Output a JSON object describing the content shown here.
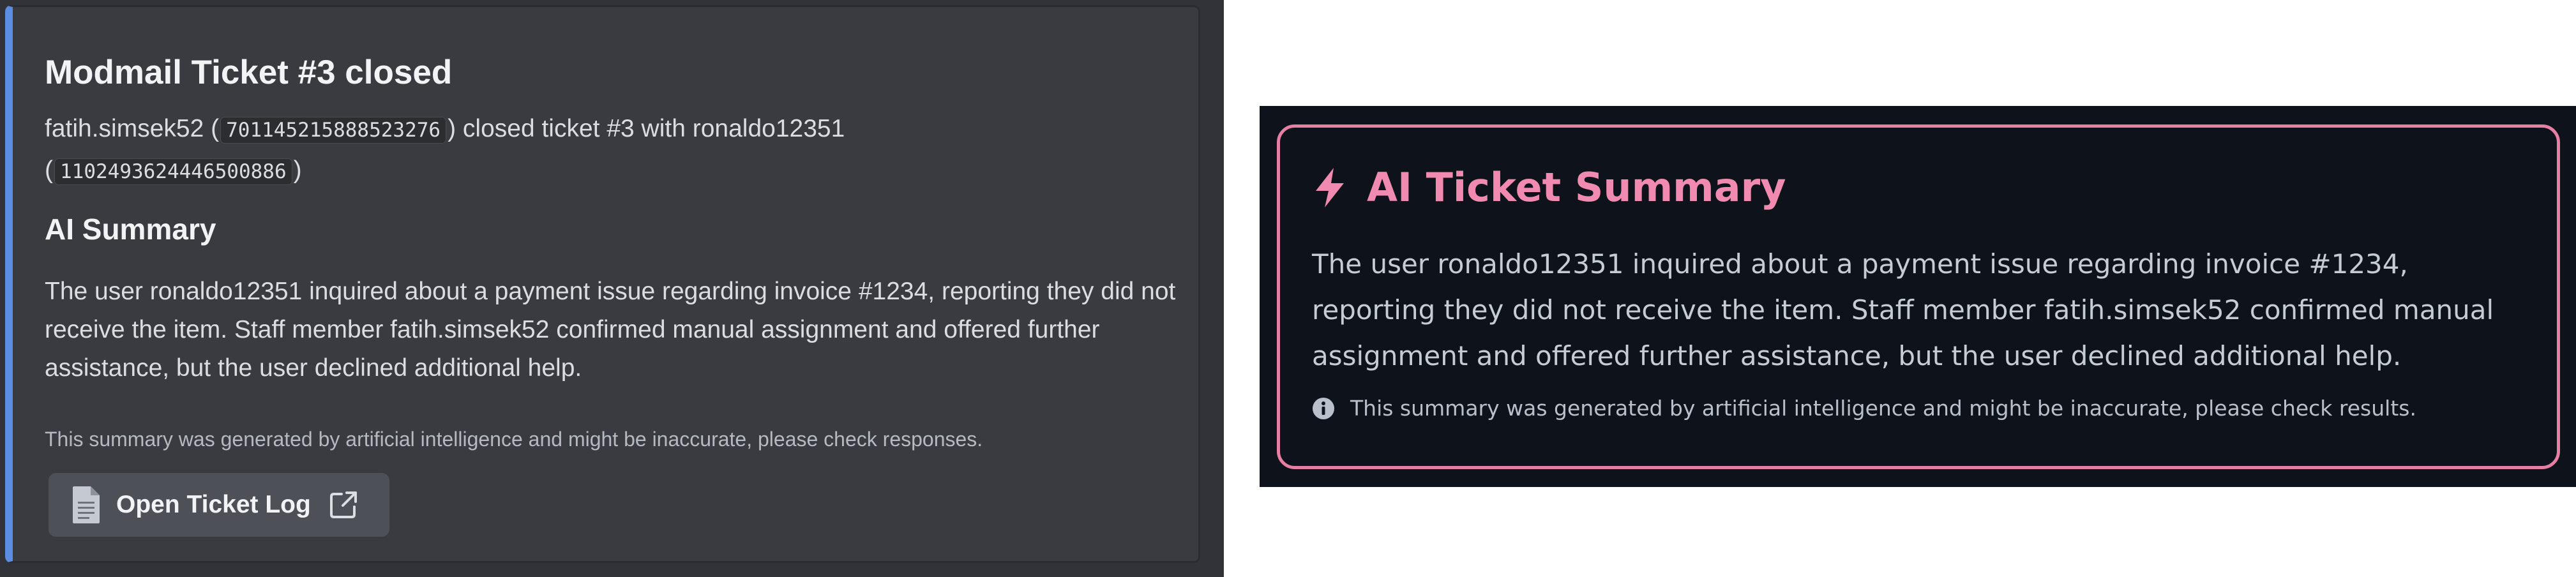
{
  "discord_embed": {
    "title": "Modmail Ticket #3 closed",
    "closer_name": "fatih.simsek52",
    "open_paren_1": "(",
    "closer_id": "701145215888523276",
    "close_text": ") closed ticket #3 with ronaldo12351",
    "open_paren_2": "(",
    "user_id": "1102493624446500886",
    "close_paren_2": ")",
    "section_title": "AI Summary",
    "summary": "The user ronaldo12351 inquired about a payment issue regarding invoice #1234, reporting they did not receive the item. Staff member fatih.simsek52 confirmed manual assignment and offered further assistance, but the user declined additional help.",
    "disclaimer": "This summary was generated by artificial intelligence and might be inaccurate, please check responses.",
    "button_label": "Open Ticket Log",
    "button_icons": [
      "document-icon",
      "external-link-icon"
    ]
  },
  "ai_summary_card": {
    "title": "AI Ticket Summary",
    "title_icon": "lightning-bolt-icon",
    "summary": "The user ronaldo12351 inquired about a payment issue regarding invoice #1234, reporting they did not receive the item. Staff member fatih.simsek52 confirmed manual assignment and offered further assistance, but the user declined additional help.",
    "note_icon": "info-icon",
    "note": "This summary was generated by artificial intelligence and might be inaccurate, please check results."
  },
  "colors": {
    "discord_bg": "#313338",
    "embed_bg": "#393b41",
    "embed_accent": "#5b8de2",
    "card_bg": "#0e121a",
    "card_accent": "#e77ea4"
  }
}
